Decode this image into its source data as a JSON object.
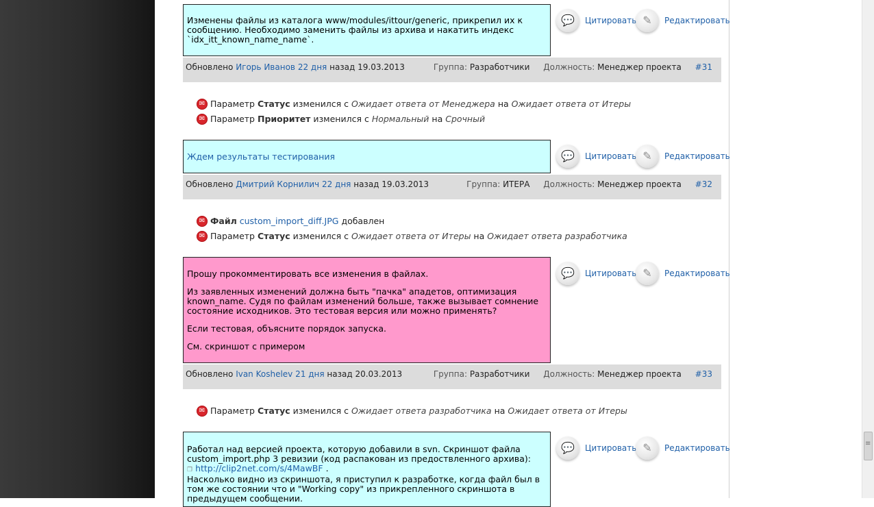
{
  "actions": {
    "quote_label": "Цитировать",
    "edit_label": "Редактировать"
  },
  "meta_labels": {
    "updated": "Обновлено",
    "ago": "назад",
    "group": "Группа:",
    "role": "Должность:"
  },
  "posts": [
    {
      "text": [
        "Изменены файлы из каталога www/modules/ittour/generic, прикрепил их к сообщению. Необходимо заменить файлы из архива и накатить индекс `idx_itt_known_name_name`."
      ],
      "author": "Игорь Иванов",
      "ago_text": "22 дня",
      "date": "19.03.2013",
      "group": "Разработчики",
      "role": "Менеджер проекта",
      "num": "#31"
    },
    {
      "text": [
        "Ждем результаты тестирования"
      ],
      "author": "Дмитрий Корнилич",
      "ago_text": "22 дня",
      "date": "19.03.2013",
      "group": "ИТЕРА",
      "role": "Менеджер проекта",
      "num": "#32"
    },
    {
      "text": [
        "Прошу прокомментировать все изменения в файлах.",
        "Из заявленных изменений должна быть \"пачка\" ападетов, оптимизация known_name. Судя по файлам изменений больше, также вызывает сомнение состояние исходников. Это тестовая версия или можно применять?",
        "Если тестовая, объясните порядок запуска.",
        "См. скриншот с примером"
      ],
      "author": "Ivan Koshelev",
      "ago_text": "21 дня",
      "date": "20.03.2013",
      "group": "Разработчики",
      "role": "Менеджер проекта",
      "num": "#33"
    },
    {
      "text_a": "Работал над версией проекта, которую добавили в svn. Скриншот файла custom_import.php 3 ревизии (код распакован из предоствленного архива):",
      "link": "http://clip2net.com/s/4MawBF",
      "link_after": ".",
      "text_b": "Насколько видно из скриншота, я приступил к разработке, когда файл был в том же состоянии что и \"Working copy\" из прикрепленного скриншота в предыдущем сообщении."
    }
  ],
  "changes": {
    "c1": {
      "pre": "Параметр",
      "field": "Статус",
      "mid": "изменился с",
      "from": "Ожидает ответа от Менеджера",
      "to_word": "на",
      "to": "Ожидает ответа от Итеры"
    },
    "c2": {
      "pre": "Параметр",
      "field": "Приоритет",
      "mid": "изменился с",
      "from": "Нормальный",
      "to_word": "на",
      "to": "Срочный"
    },
    "c3": {
      "field": "Файл",
      "file": "custom_import_diff.JPG",
      "suffix": "добавлен"
    },
    "c4": {
      "pre": "Параметр",
      "field": "Статус",
      "mid": "изменился с",
      "from": "Ожидает ответа от Итеры",
      "to_word": "на",
      "to": "Ожидает ответа разработчика"
    },
    "c5": {
      "pre": "Параметр",
      "field": "Статус",
      "mid": "изменился с",
      "from": "Ожидает ответа разработчика",
      "to_word": "на",
      "to": "Ожидает ответа от Итеры"
    }
  }
}
